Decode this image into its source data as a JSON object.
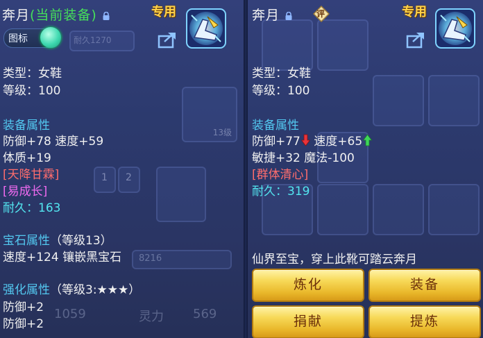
{
  "left": {
    "item_name": "奔月",
    "current_equipped": "(当前装备)",
    "special_tag": "专用",
    "toggle_label": "图标",
    "type": "类型：女鞋",
    "level": "等级：100",
    "attr_header": "装备属性",
    "attr_line1": "防御+78 速度+59",
    "attr_line2": "体质+19",
    "effect1": "[天降甘霖]",
    "effect2": "[易成长]",
    "durability_label": "耐久：",
    "durability_value": "163",
    "gem_header": "宝石属性",
    "gem_level": "（等级13）",
    "gem_line": "速度+124 镶嵌黑宝石",
    "enhance_header": "强化属性",
    "enhance_level": "（等级3:★★★）",
    "enhance_line1": "防御+2",
    "enhance_line2": "防御+2",
    "bg_text": {
      "durability": "耐久1270",
      "quality": "13级",
      "slot1": "1",
      "slot2": "2",
      "number1": "8216",
      "number2": "1059",
      "spirit": "灵力",
      "spirit_value": "569"
    }
  },
  "right": {
    "item_name": "奔月",
    "eval_badge": "评",
    "special_tag": "专用",
    "type": "类型：女鞋",
    "level": "等级：100",
    "attr_header": "装备属性",
    "defense": "防御+77",
    "speed": "速度+65",
    "attr_line2": "敏捷+32 魔法-100",
    "effect1": "[群体清心]",
    "durability_label": "耐久：",
    "durability_value": "319",
    "description": "仙界至宝，穿上此靴可踏云奔月",
    "buttons": {
      "refine": "炼化",
      "equip": "装备",
      "donate": "捐献",
      "extract": "提炼"
    }
  },
  "colors": {
    "section": "#53c8f0",
    "green": "#46e05a",
    "red_effect": "#ff6d6d",
    "magenta_effect": "#f06af0",
    "gold_button": "#f7d958",
    "special_tag": "#ffd24a"
  },
  "icons": [
    "lock-icon",
    "share-icon",
    "boot-item-icon",
    "toggle-knob",
    "down-arrow-icon",
    "up-arrow-icon",
    "evaluate-badge-icon"
  ]
}
